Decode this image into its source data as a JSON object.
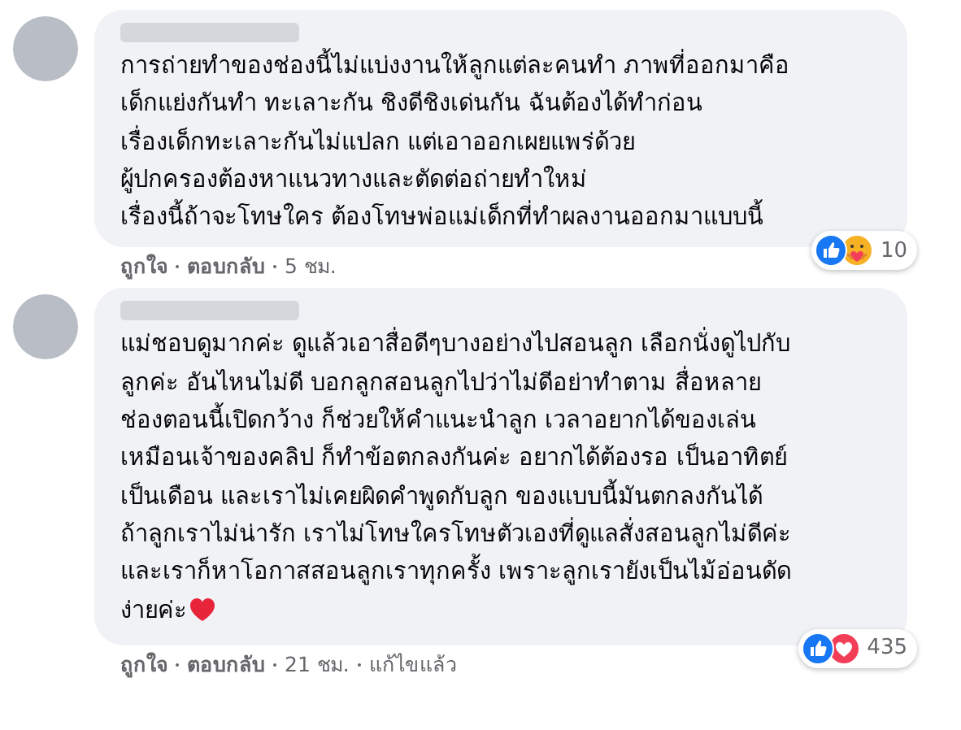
{
  "comments": [
    {
      "text": "การถ่ายทำของช่องนี้ไม่แบ่งงานให้ลูกแต่ละคนทำ ภาพที่ออกมาคือ\nเด็กแย่งกันทำ ทะเลาะกัน ชิงดีชิงเด่นกัน ฉันต้องได้ทำก่อน\nเรื่องเด็กทะเลาะกันไม่แปลก แต่เอาออกเผยแพร่ด้วย\nผู้ปกครองต้องหาแนวทางและตัดต่อถ่ายทำใหม่\nเรื่องนี้ถ้าจะโทษใคร ต้องโทษพ่อแม่เด็กที่ทำผลงานออกมาแบบนี้",
      "ends_with_heart": false,
      "reactions": [
        {
          "kind": "like"
        },
        {
          "kind": "care"
        }
      ],
      "reaction_count": "10",
      "actions": [
        "ถูกใจ",
        "ตอบกลับ",
        "5 ชม."
      ]
    },
    {
      "text": "แม่ชอบดูมากค่ะ ดูแล้วเอาสื่อดีๆบางอย่างไปสอนลูก เลือกนั่งดูไปกับ\nลูกค่ะ อันไหนไม่ดี บอกลูกสอนลูกไปว่าไม่ดีอย่าทำตาม สื่อหลาย\nช่องตอนนี้เปิดกว้าง ก็ช่วยให้คำแนะนำลูก เวลาอยากได้ของเล่น\nเหมือนเจ้าของคลิป ก็ทำข้อตกลงกันค่ะ อยากได้ต้องรอ เป็นอาทิตย์\nเป็นเดือน และเราไม่เคยผิดคำพูดกับลูก ของแบบนี้มันตกลงกันได้\nถ้าลูกเราไม่น่ารัก เราไม่โทษใครโทษตัวเองที่ดูแลสั่งสอนลูกไม่ดีค่ะ\nและเราก็หาโอกาสสอนลูกเราทุกครั้ง เพราะลูกเรายังเป็นไม้อ่อนดัด\nง่ายค่ะ",
      "ends_with_heart": true,
      "reactions": [
        {
          "kind": "like"
        },
        {
          "kind": "love"
        }
      ],
      "reaction_count": "435",
      "actions": [
        "ถูกใจ",
        "ตอบกลับ",
        "21 ชม.",
        "แก้ไขแล้ว"
      ]
    }
  ]
}
